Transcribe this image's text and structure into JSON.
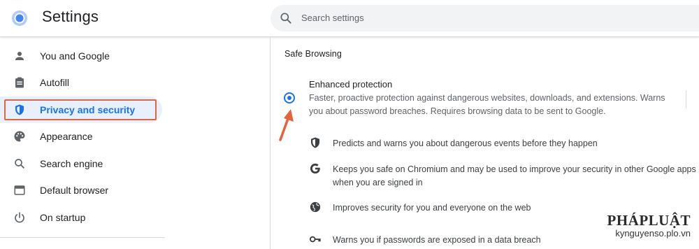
{
  "header": {
    "title": "Settings",
    "search_placeholder": "Search settings",
    "logo_icon": "chromium-logo-icon",
    "search_icon": "search-icon"
  },
  "sidebar": {
    "items": [
      {
        "label": "You and Google",
        "icon": "person-icon",
        "active": false
      },
      {
        "label": "Autofill",
        "icon": "clipboard-icon",
        "active": false
      },
      {
        "label": "Privacy and security",
        "icon": "shield-icon",
        "active": true
      },
      {
        "label": "Appearance",
        "icon": "palette-icon",
        "active": false
      },
      {
        "label": "Search engine",
        "icon": "search-icon",
        "active": false
      },
      {
        "label": "Default browser",
        "icon": "browser-icon",
        "active": false
      },
      {
        "label": "On startup",
        "icon": "power-icon",
        "active": false
      }
    ]
  },
  "main": {
    "section_title": "Safe Browsing",
    "option": {
      "title": "Enhanced protection",
      "description": "Faster, proactive protection against dangerous websites, downloads, and extensions. Warns you about password breaches. Requires browsing data to be sent to Google.",
      "selected": true
    },
    "features": [
      {
        "icon": "shield-icon",
        "text": "Predicts and warns you about dangerous events before they happen"
      },
      {
        "icon": "google-g-icon",
        "text": "Keeps you safe on Chromium and may be used to improve your security in other Google apps when you are signed in"
      },
      {
        "icon": "globe-icon",
        "text": "Improves security for you and everyone on the web"
      },
      {
        "icon": "key-icon",
        "text": "Warns you if passwords are exposed in a data breach"
      }
    ]
  },
  "watermark": {
    "logo": "PHÁPLUẬT",
    "url": "kynguyenso.plo.vn"
  },
  "colors": {
    "accent": "#1a73e8",
    "active_bg": "#e8f0fe",
    "annotation": "#e3643c"
  }
}
